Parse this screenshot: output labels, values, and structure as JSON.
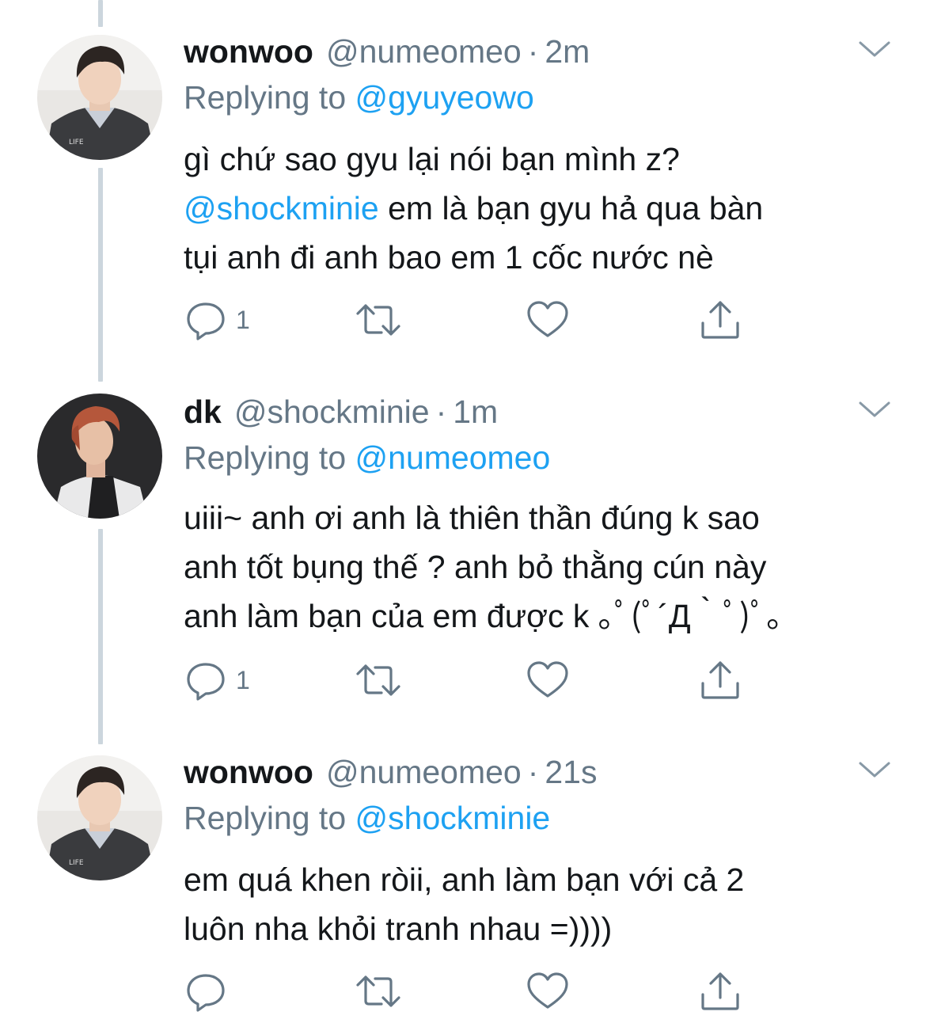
{
  "colors": {
    "link": "#1da1f2",
    "muted": "#657786",
    "text": "#14171a",
    "thread": "#ccd6dd"
  },
  "tweets": [
    {
      "name": "wonwoo",
      "handle": "@numeomeo",
      "dot": "·",
      "time": "2m",
      "replying_prefix": "Replying to",
      "replying_to": "@gyuyeowo",
      "body_line1": "gì chứ sao gyu lại nói bạn mình z?",
      "body_mention": "@shockminie",
      "body_line2_rest": " em là bạn gyu hả qua bàn",
      "body_line3": "tụi anh đi anh bao em 1 cốc nước nè",
      "reply_count": "1",
      "avatar_icon": "avatar-photo-wonwoo"
    },
    {
      "name": "dk",
      "handle": "@shockminie",
      "dot": "·",
      "time": "1m",
      "replying_prefix": "Replying to",
      "replying_to": "@numeomeo",
      "body_line1": "uiii~ anh ơi anh là thiên thần đúng k sao",
      "body_line2": "anh tốt bụng thế ? anh bỏ thằng cún này",
      "body_line3": "anh làm bạn của em được k ｡ﾟ(ﾟ´Д｀ﾟ)ﾟ｡",
      "reply_count": "1",
      "avatar_icon": "avatar-photo-dk"
    },
    {
      "name": "wonwoo",
      "handle": "@numeomeo",
      "dot": "·",
      "time": "21s",
      "replying_prefix": "Replying to",
      "replying_to": "@shockminie",
      "body_line1": "em quá khen ròii, anh làm bạn với cả 2",
      "body_line2": "luôn nha khỏi tranh nhau =))))",
      "reply_count": "",
      "avatar_icon": "avatar-photo-wonwoo"
    }
  ]
}
